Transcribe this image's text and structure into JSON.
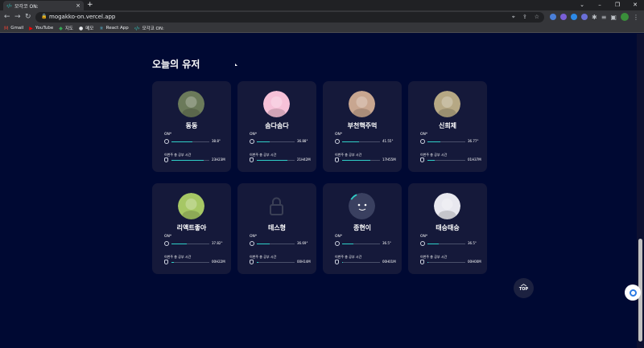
{
  "browser": {
    "tab_title": "모각코 ON:",
    "tab_close": "×",
    "new_tab": "+",
    "url": "mogakko-on.vercel.app",
    "window_controls": [
      "⌄",
      "–",
      "❐",
      "✕"
    ],
    "bookmarks": [
      {
        "label": "Gmail",
        "icon": "gmail-icon",
        "glyph": "M",
        "color": "#ea4335"
      },
      {
        "label": "YouTube",
        "icon": "youtube-icon",
        "glyph": "▶",
        "color": "#ff0000"
      },
      {
        "label": "지도",
        "icon": "maps-icon",
        "glyph": "◆",
        "color": "#34a853"
      },
      {
        "label": "메모",
        "icon": "memo-icon",
        "glyph": "●",
        "color": "#e8eaed"
      },
      {
        "label": "React App",
        "icon": "react-icon",
        "glyph": "⚛",
        "color": "#61dafb"
      },
      {
        "label": "모각코 ON:",
        "icon": "mogakko-icon",
        "glyph": "‹/›",
        "color": "#2fd0c8"
      }
    ]
  },
  "section": {
    "title": "오늘의 유저"
  },
  "users": [
    {
      "name": "동동",
      "status": "ON*",
      "temp": "38.8°",
      "temp_level": 0.55,
      "study_label": "이번주 총 공부 시간",
      "study_time": "23H23M",
      "study_level": 0.85,
      "avatar_color": "#6b7a5a"
    },
    {
      "name": "솜다솜다",
      "status": "ON*",
      "temp": "36.88°",
      "temp_level": 0.35,
      "study_label": "이번주 총 공부 시간",
      "study_time": "21H42M",
      "study_level": 0.8,
      "avatar_color": "#f6c1d8"
    },
    {
      "name": "부천핵주먹",
      "status": "ON*",
      "temp": "41.55°",
      "temp_level": 0.45,
      "study_label": "이번주 총 공부 시간",
      "study_time": "17H55M",
      "study_level": 0.75,
      "avatar_color": "#c8a690"
    },
    {
      "name": "신희제",
      "status": "ON*",
      "temp": "36.77°",
      "temp_level": 0.35,
      "study_label": "이번주 총 공부 시간",
      "study_time": "01H37M",
      "study_level": 0.2,
      "avatar_color": "#b6a884"
    },
    {
      "name": "리액트좋아",
      "status": "ON*",
      "temp": "37.82°",
      "temp_level": 0.4,
      "study_label": "이번주 총 공부 시간",
      "study_time": "00H22M",
      "study_level": 0.06,
      "avatar_color": "#a6c765"
    },
    {
      "name": "테스형",
      "status": "ON*",
      "temp": "36.69°",
      "temp_level": 0.35,
      "study_label": "이번주 총 공부 시간",
      "study_time": "00H14M",
      "study_level": 0.04,
      "avatar_color": "#15193a"
    },
    {
      "name": "종현이",
      "status": "ON*",
      "temp": "36.5°",
      "temp_level": 0.3,
      "study_label": "이번주 총 공부 시간",
      "study_time": "00H01M",
      "study_level": 0.02,
      "avatar_color": "#3a4060"
    },
    {
      "name": "태승태승",
      "status": "ON*",
      "temp": "36.5°",
      "temp_level": 0.3,
      "study_label": "이번주 총 공부 시간",
      "study_time": "00H00M",
      "study_level": 0.02,
      "avatar_color": "#e8e8ef"
    }
  ],
  "top_button": {
    "label": "TOP",
    "arrow": "︿"
  }
}
